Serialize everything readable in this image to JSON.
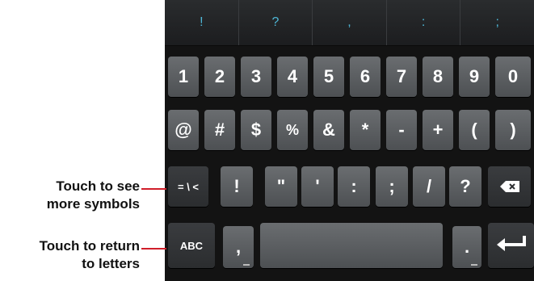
{
  "suggestions": [
    "!",
    "?",
    ",",
    ":",
    ";"
  ],
  "rows": {
    "numbers": [
      "1",
      "2",
      "3",
      "4",
      "5",
      "6",
      "7",
      "8",
      "9",
      "0"
    ],
    "symbols1": [
      "@",
      "#",
      "$",
      "%",
      "&",
      "*",
      "-",
      "+",
      "(",
      ")"
    ],
    "symbols2": {
      "toggle": "= \\ <",
      "keys": [
        "!",
        "\"",
        "'",
        ":",
        ";",
        "/",
        "?"
      ],
      "delete_icon": "backspace-icon"
    },
    "bottom": {
      "abc": "ABC",
      "comma": ",",
      "period": ".",
      "enter_icon": "enter-icon"
    }
  },
  "callouts": {
    "more_symbols": [
      "Touch to see",
      "more symbols"
    ],
    "return_letters": [
      "Touch to return",
      "to letters"
    ]
  },
  "colors": {
    "callout_line": "#d01e2a",
    "suggestion_text": "#4fb8d8"
  }
}
